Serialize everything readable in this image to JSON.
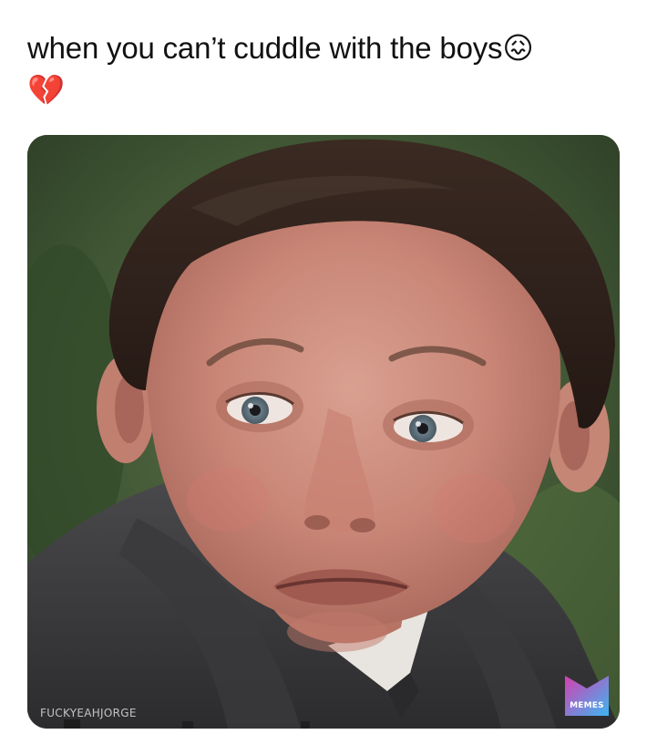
{
  "post": {
    "caption": "when you can’t cuddle with the boys",
    "caption_emojis": [
      "😖",
      "💔"
    ],
    "image": {
      "subject": "crying-boy-photo",
      "watermark": "FUCKYEAHJORGE",
      "logo_label": "MEMES"
    }
  },
  "colors": {
    "background": "#ffffff",
    "caption_text": "#111111",
    "logo_gradient_start": "#d53fb0",
    "logo_gradient_end": "#3db6f2"
  }
}
